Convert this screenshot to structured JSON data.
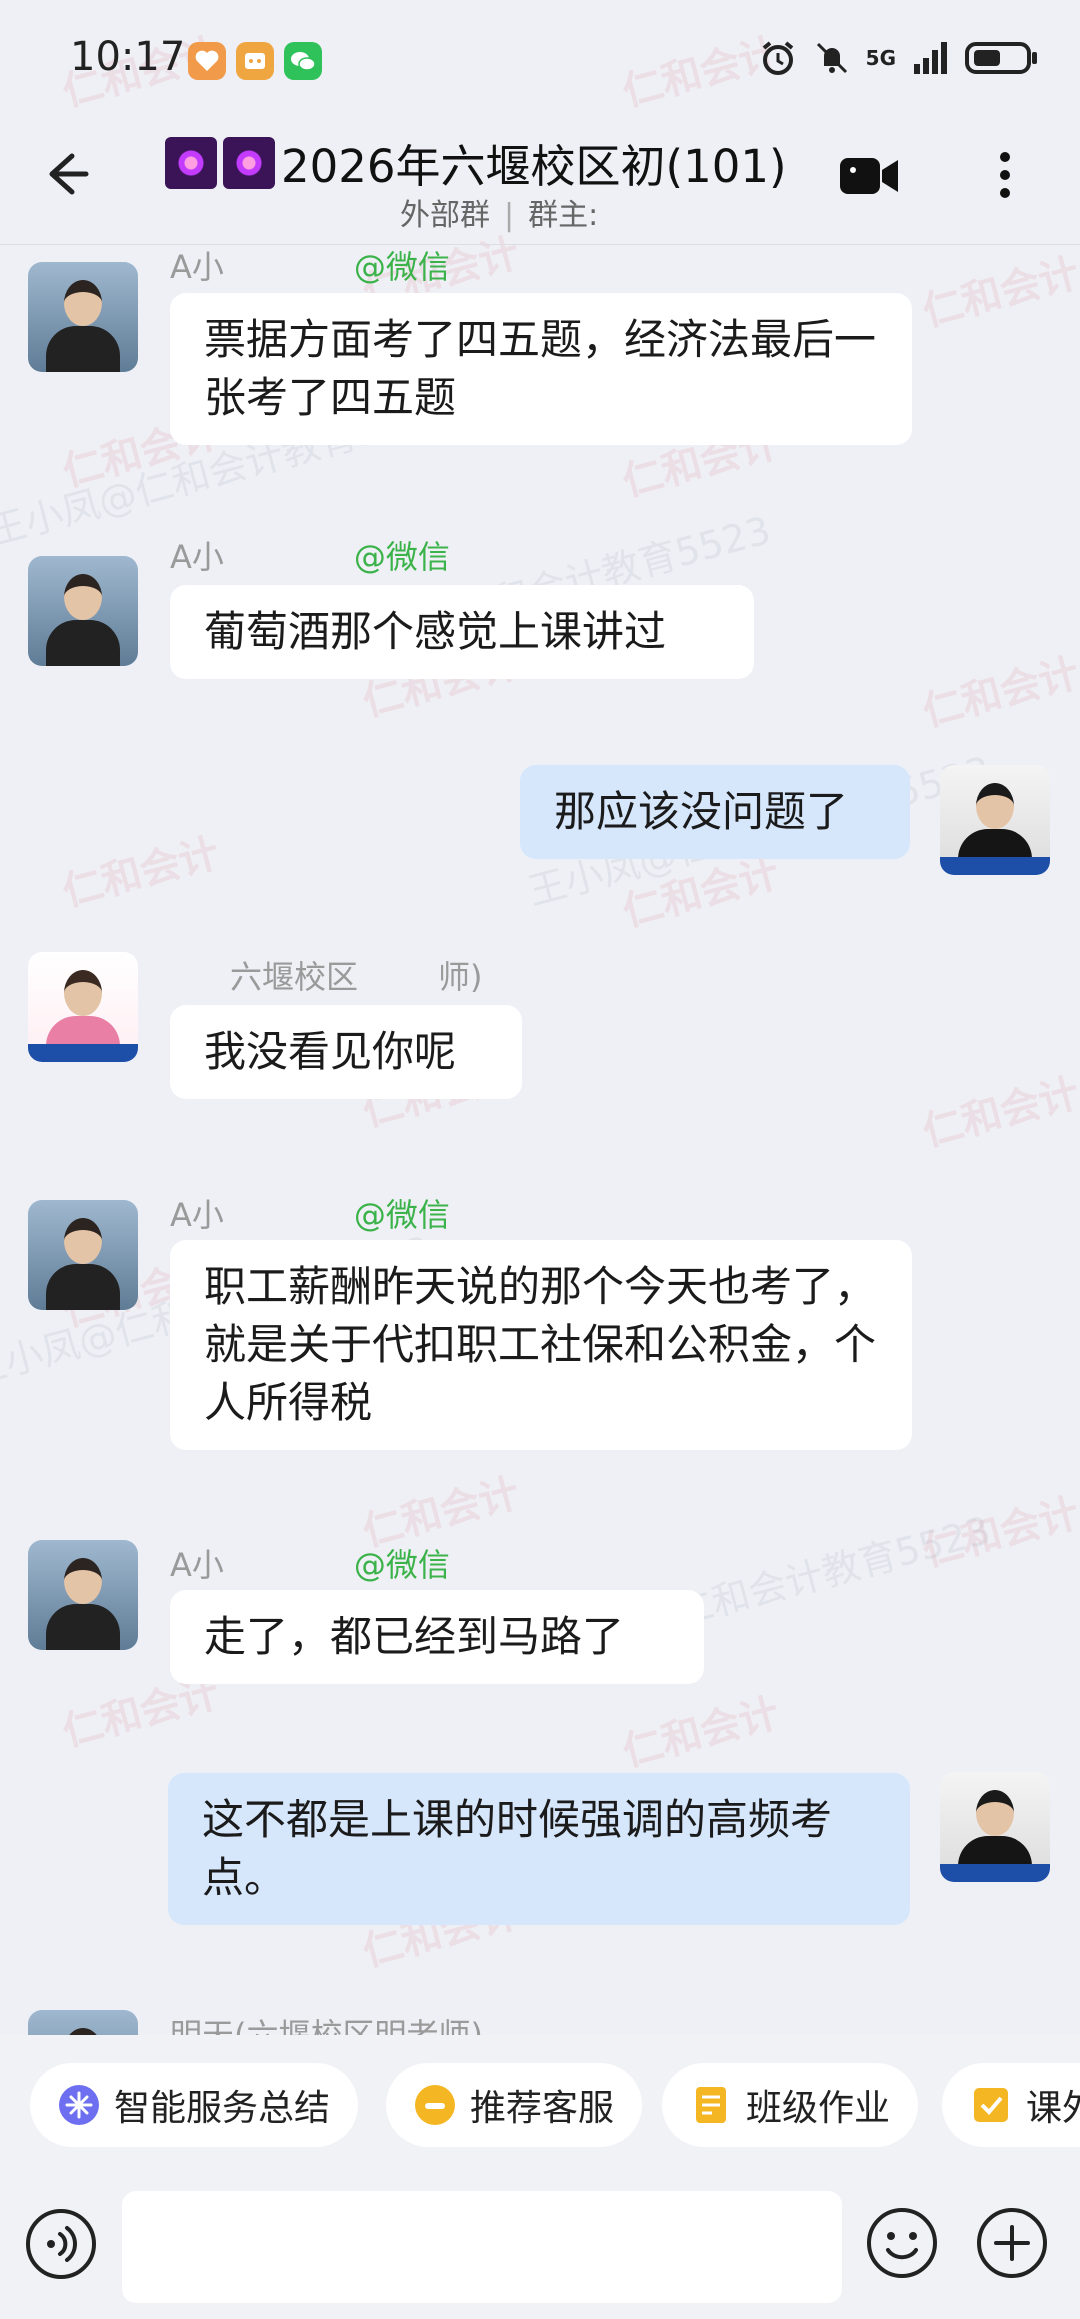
{
  "status_bar": {
    "time": "10:17",
    "network": "5G",
    "icons": [
      "alarm-icon",
      "mute-icon",
      "signal-icon",
      "battery-icon"
    ]
  },
  "header": {
    "title": "2026年六堰校区初(101)",
    "external_group": "外部群",
    "owner_label": "群主:"
  },
  "watermark": {
    "brand": "仁和会计",
    "line": "王小凤@仁和会计教育5523"
  },
  "messages": [
    {
      "sender": "A小",
      "tag": "@微信",
      "text": "票据方面考了四五题，经济法最后一张考了四五题",
      "side": "left"
    },
    {
      "sender": "A小",
      "tag": "@微信",
      "text": "葡萄酒那个感觉上课讲过",
      "side": "left"
    },
    {
      "text": "那应该没问题了",
      "side": "right"
    },
    {
      "sender": "六堰校区",
      "tag": "师)",
      "text": "我没看见你呢",
      "side": "left"
    },
    {
      "sender": "A小",
      "tag": "@微信",
      "text": "职工薪酬昨天说的那个今天也考了，就是关于代扣职工社保和公积金，个人所得税",
      "side": "left"
    },
    {
      "sender": "A小",
      "tag": "@微信",
      "text": "走了，都已经到马路了",
      "side": "left"
    },
    {
      "text": "这不都是上课的时候强调的高频考点。",
      "side": "right"
    },
    {
      "sender": "明天(六堰校区明老师)",
      "side": "left"
    }
  ],
  "quick_actions": [
    {
      "label": "智能服务总结",
      "icon": "sparkle-icon"
    },
    {
      "label": "推荐客服",
      "icon": "chat-icon"
    },
    {
      "label": "班级作业",
      "icon": "homework-icon"
    },
    {
      "label": "课外",
      "icon": "check-icon"
    }
  ],
  "input": {
    "placeholder": ""
  },
  "colors": {
    "background": "#eef0f6",
    "wechat_tag": "#3cb34a",
    "own_bubble": "#d6e6fb",
    "other_bubble": "#ffffff"
  }
}
